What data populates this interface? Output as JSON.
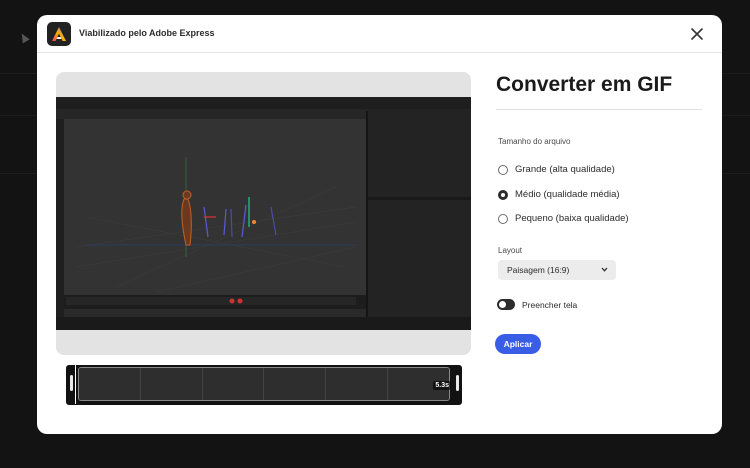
{
  "dialog": {
    "title": "Viabilizado pelo Adobe Express",
    "logo_icon": "adobe-express-logo",
    "close_icon": "close-icon"
  },
  "preview": {
    "duration": "5.3s",
    "frame_count": 6
  },
  "panel": {
    "title": "Converter em GIF",
    "file_size_label": "Tamanho do arquivo",
    "options": [
      {
        "label": "Grande (alta qualidade)",
        "selected": false
      },
      {
        "label": "Médio (qualidade média)",
        "selected": true
      },
      {
        "label": "Pequeno (baixa qualidade)",
        "selected": false
      }
    ],
    "layout_label": "Layout",
    "layout_value": "Paisagem (16:9)",
    "fill_toggle_label": "Preencher tela",
    "fill_toggle_on": true,
    "apply_label": "Aplicar"
  },
  "colors": {
    "accent": "#3a5de8",
    "backdrop": "#131313"
  }
}
